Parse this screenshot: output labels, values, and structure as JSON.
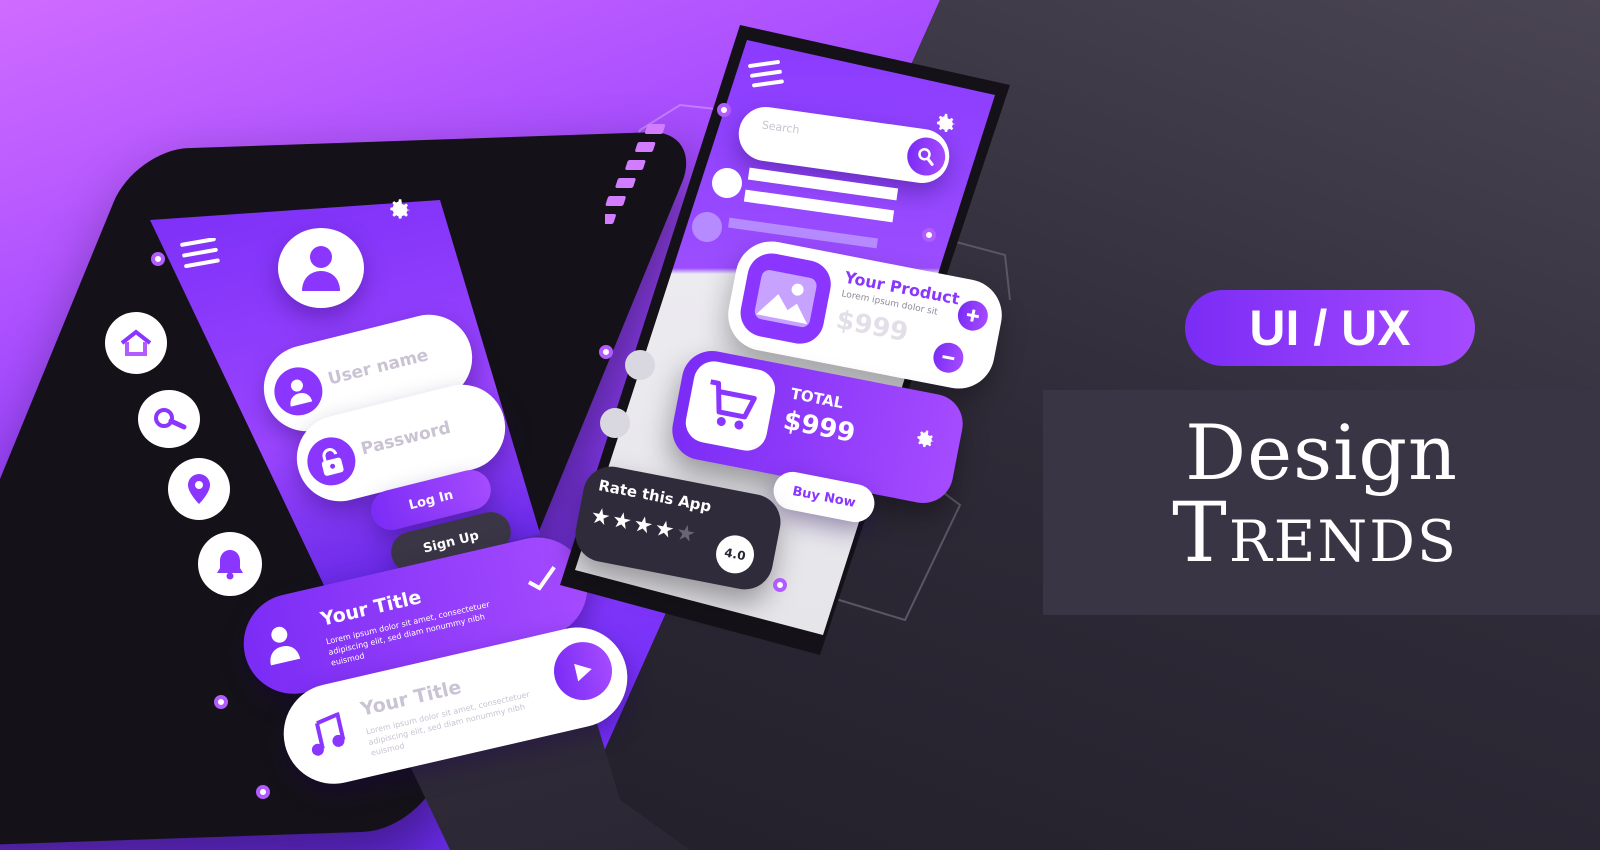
{
  "headline": {
    "badge": "UI / UX",
    "line1": "Design",
    "line2": "Trends"
  },
  "login_phone": {
    "username_placeholder": "User name",
    "password_placeholder": "Password",
    "login_label": "Log In",
    "signup_label": "Sign Up"
  },
  "side_icons": [
    "home-icon",
    "search-icon",
    "location-pin-icon",
    "bell-icon"
  ],
  "cards": [
    {
      "title": "Your Title",
      "body": "Lorem ipsum dolor sit amet, consectetuer adipiscing elit, sed diam nonummy nibh euismod",
      "icon": "user-icon",
      "action_icon": "check-icon"
    },
    {
      "title": "Your Title",
      "body": "Lorem ipsum dolor sit amet, consectetuer adipiscing elit, sed diam nonummy nibh euismod",
      "icon": "music-note-icon",
      "action_icon": "play-icon"
    }
  ],
  "shop_phone": {
    "search_placeholder": "Search",
    "product_title": "Your Product",
    "product_desc": "Lorem ipsum dolor sit",
    "product_price": "$999",
    "total_label": "TOTAL",
    "total_price": "$999",
    "buy_label": "Buy Now",
    "rate_label": "Rate this App",
    "rating": "4.0",
    "rating_value": 4,
    "rating_max": 5
  },
  "colors": {
    "accent": "#8a36ff",
    "accent_light": "#b25cff",
    "dark": "#2a2534"
  }
}
